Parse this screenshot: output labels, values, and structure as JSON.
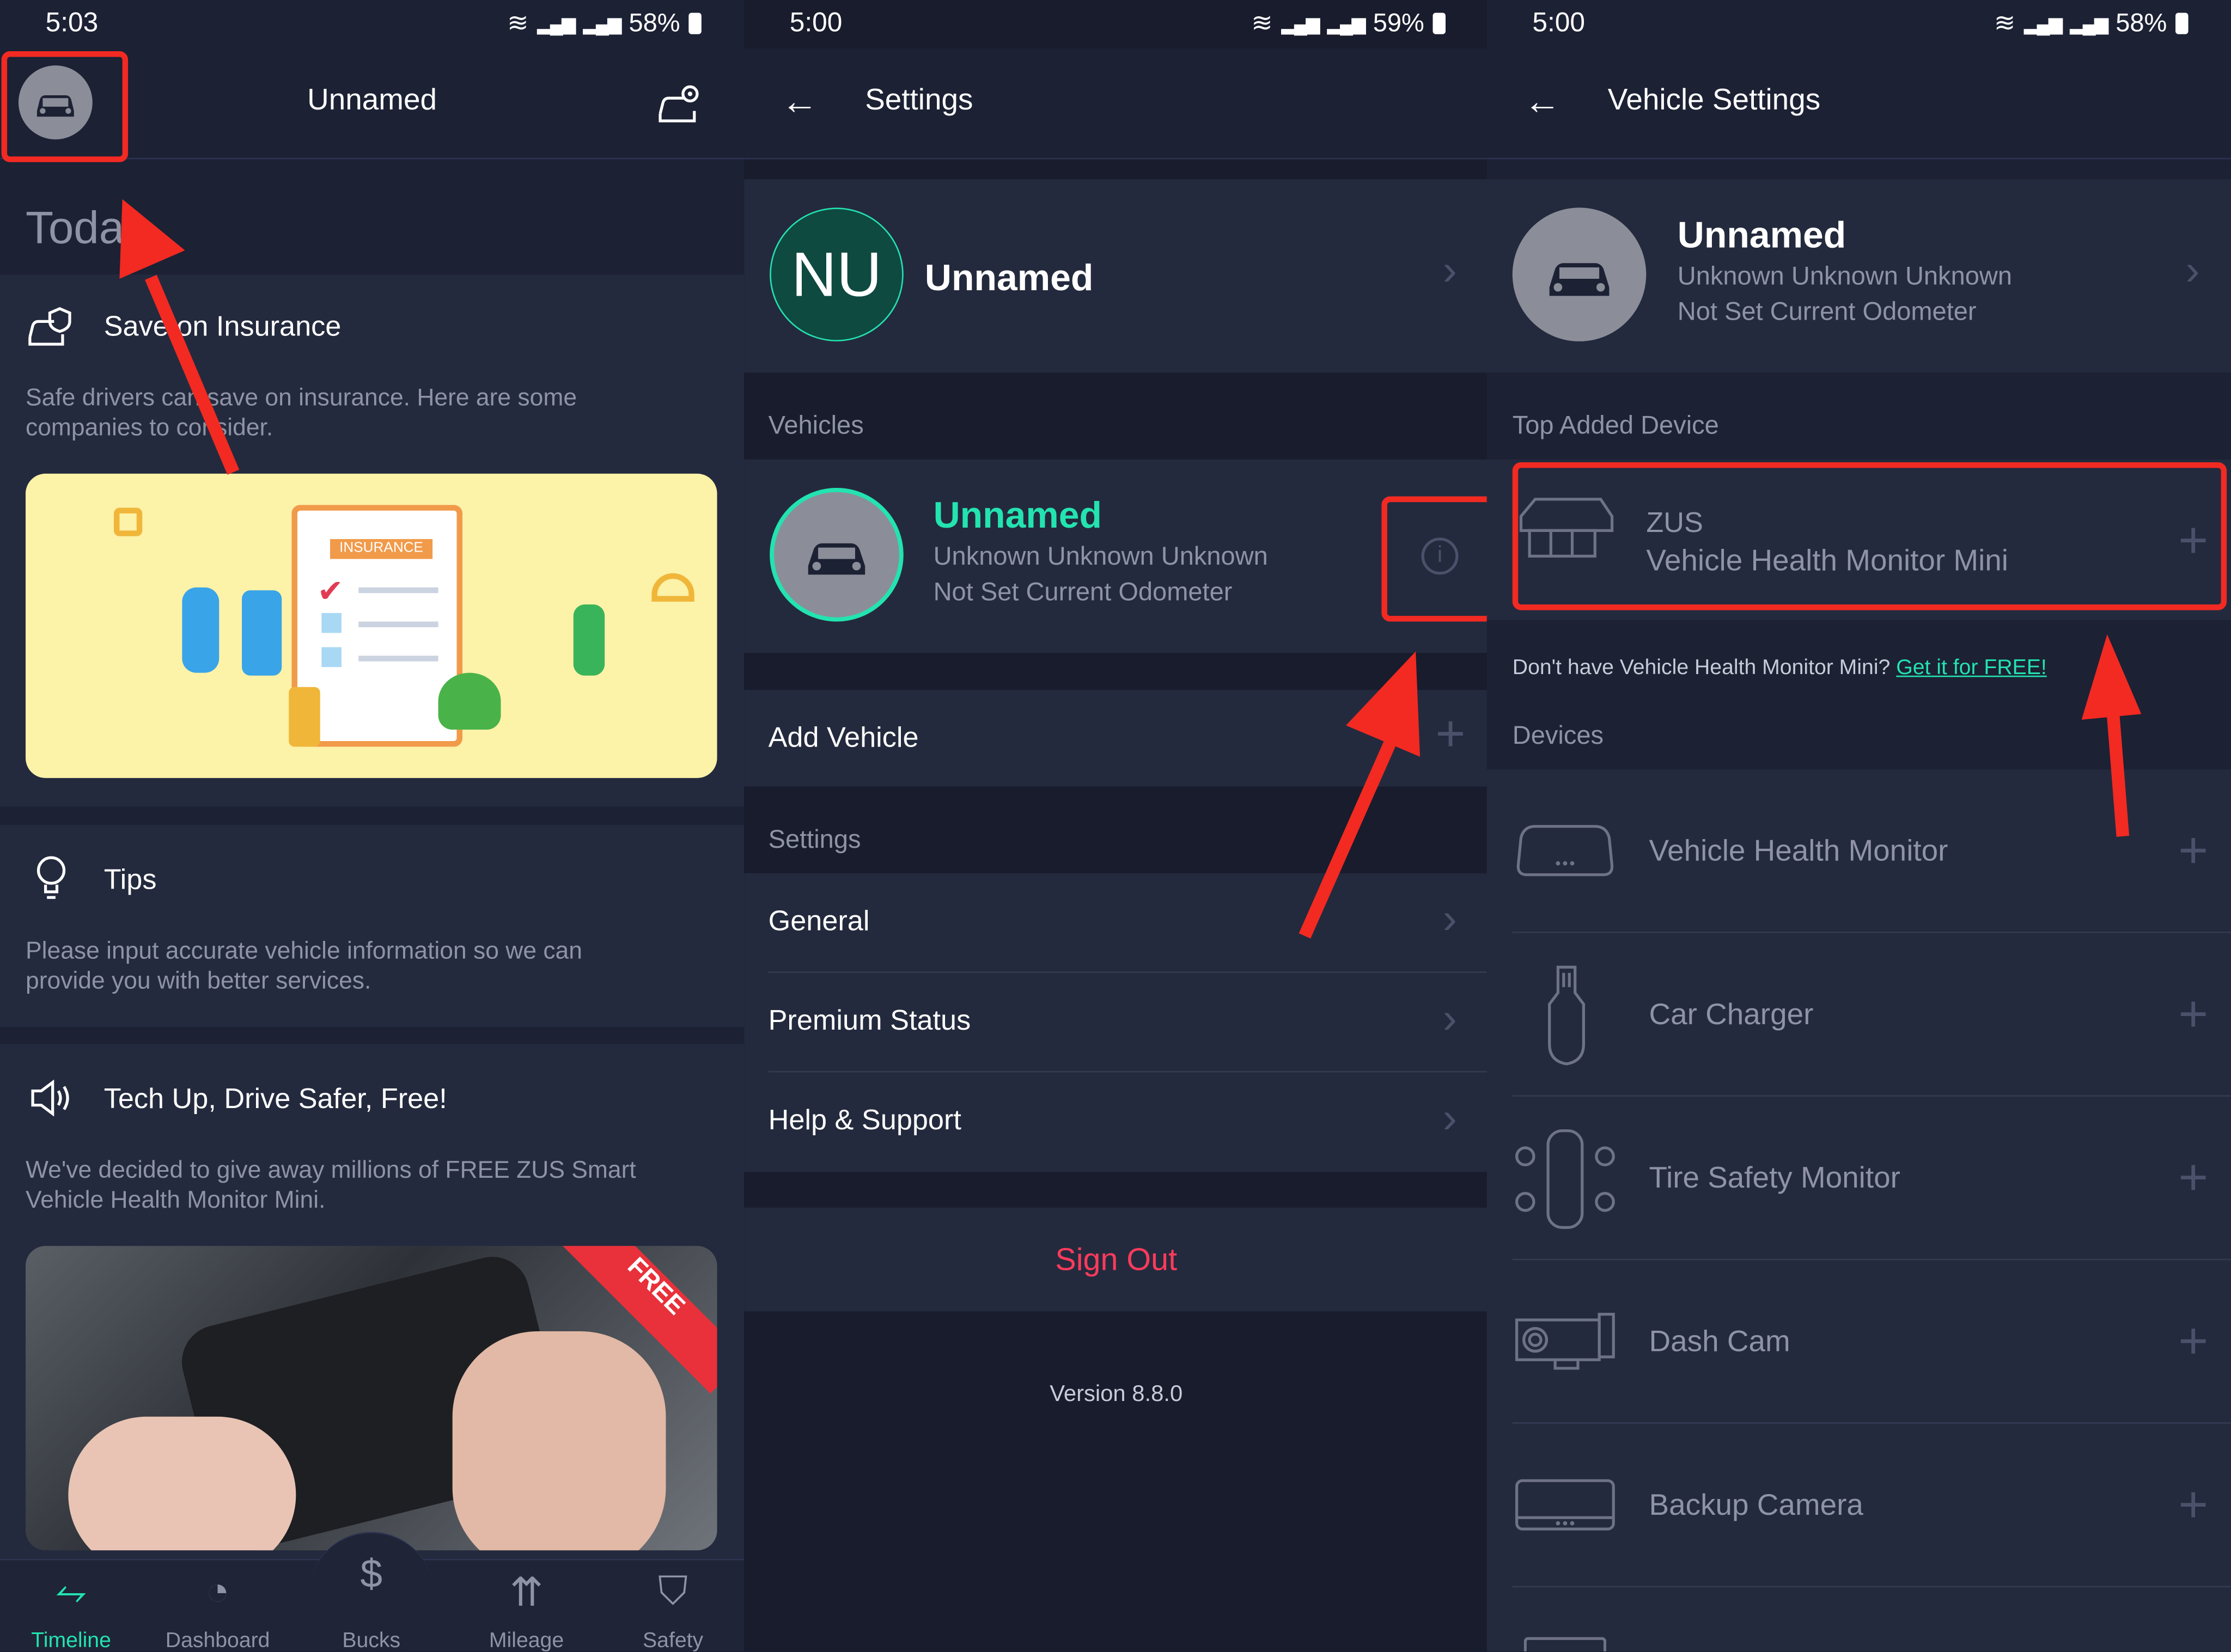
{
  "colors": {
    "accent": "#23e3b0",
    "danger": "#ff3b5c",
    "annotation": "#f22a22",
    "link": "#23e3b0"
  },
  "panel1": {
    "status": {
      "time": "5:03",
      "battery": "58%"
    },
    "header": {
      "title": "Unnamed"
    },
    "today_label": "Today",
    "cards": [
      {
        "title": "Save on Insurance",
        "body": "Safe drivers can save on insurance. Here are some companies to consider.",
        "image_label": "INSURANCE"
      },
      {
        "title": "Tips",
        "body": "Please input accurate vehicle information so we can provide you with better services."
      },
      {
        "title": "Tech Up, Drive Safer, Free!",
        "body": "We've decided to give away millions of FREE ZUS Smart Vehicle Health Monitor Mini.",
        "ribbon": "FREE"
      }
    ],
    "nav": [
      "Timeline",
      "Dashboard",
      "Bucks",
      "Mileage",
      "Safety"
    ]
  },
  "panel2": {
    "status": {
      "time": "5:00",
      "battery": "59%"
    },
    "header": {
      "title": "Settings"
    },
    "profile": {
      "initials": "NU",
      "name": "Unnamed"
    },
    "vehicles_label": "Vehicles",
    "vehicle": {
      "name": "Unnamed",
      "line1": "Unknown Unknown Unknown",
      "line2": "Not Set Current Odometer"
    },
    "add_vehicle": "Add Vehicle",
    "settings_label": "Settings",
    "settings_items": [
      "General",
      "Premium Status",
      "Help & Support"
    ],
    "sign_out": "Sign Out",
    "version": "Version 8.8.0"
  },
  "panel3": {
    "status": {
      "time": "5:00",
      "battery": "58%"
    },
    "header": {
      "title": "Vehicle Settings"
    },
    "vehicle": {
      "name": "Unnamed",
      "line1": "Unknown Unknown Unknown",
      "line2": "Not Set Current Odometer"
    },
    "top_device_label": "Top Added Device",
    "top_device": {
      "brand": "ZUS",
      "name": "Vehicle Health Monitor Mini"
    },
    "promo_text": "Don't have Vehicle Health Monitor Mini?",
    "promo_link": "Get it for FREE!",
    "devices_label": "Devices",
    "devices": [
      "Vehicle Health Monitor",
      "Car Charger",
      "Tire Safety Monitor",
      "Dash Cam",
      "Backup Camera"
    ]
  }
}
